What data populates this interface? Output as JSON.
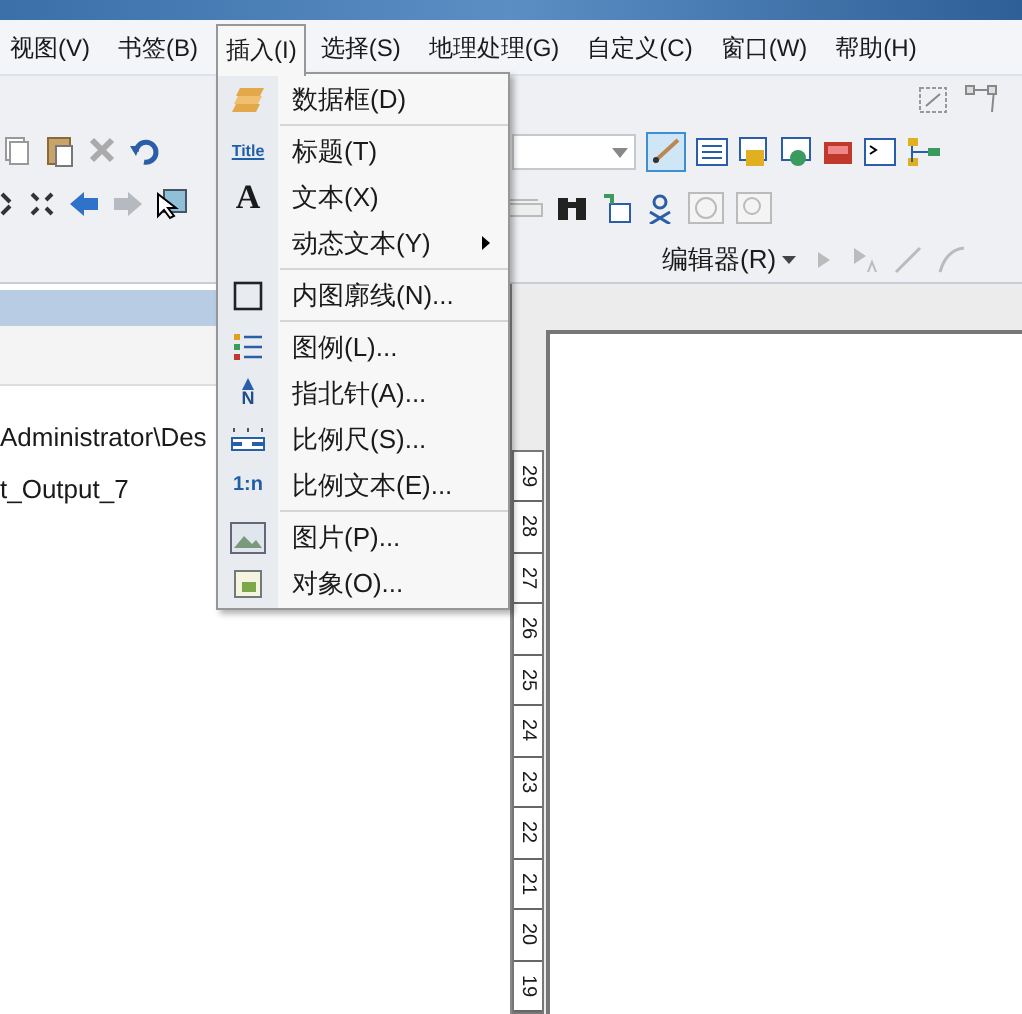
{
  "menu_bar": [
    {
      "label": "视图(V)",
      "selected": false
    },
    {
      "label": "书签(B)",
      "selected": false
    },
    {
      "label": "插入(I)",
      "selected": true
    },
    {
      "label": "选择(S)",
      "selected": false
    },
    {
      "label": "地理处理(G)",
      "selected": false
    },
    {
      "label": "自定义(C)",
      "selected": false
    },
    {
      "label": "窗口(W)",
      "selected": false
    },
    {
      "label": "帮助(H)",
      "selected": false
    }
  ],
  "editor_toolbar": {
    "label": "编辑器(R)"
  },
  "table_of_contents": {
    "lines": [
      "Administrator\\Des",
      "t_Output_7"
    ]
  },
  "insert_menu": [
    {
      "label": "数据框(D)",
      "kind": "layers",
      "separator_after": true
    },
    {
      "label": "标题(T)",
      "kind": "text_icon",
      "icon_text": "Title"
    },
    {
      "label": "文本(X)",
      "kind": "text_icon",
      "icon_text": "A"
    },
    {
      "label": "动态文本(Y)",
      "kind": "plain",
      "has_submenu": true,
      "separator_after": true
    },
    {
      "label": "内图廓线(N)...",
      "kind": "frame",
      "separator_after": true
    },
    {
      "label": "图例(L)...",
      "kind": "legend"
    },
    {
      "label": "指北针(A)...",
      "kind": "north",
      "icon_text": "N"
    },
    {
      "label": "比例尺(S)...",
      "kind": "scalebar"
    },
    {
      "label": "比例文本(E)...",
      "kind": "text_icon",
      "icon_text": "1:n",
      "separator_after": true
    },
    {
      "label": "图片(P)...",
      "kind": "image"
    },
    {
      "label": "对象(O)...",
      "kind": "object"
    }
  ],
  "ruler": {
    "labels": [
      "29",
      "28",
      "27",
      "26",
      "25",
      "24",
      "23",
      "22",
      "21",
      "20",
      "19"
    ]
  }
}
